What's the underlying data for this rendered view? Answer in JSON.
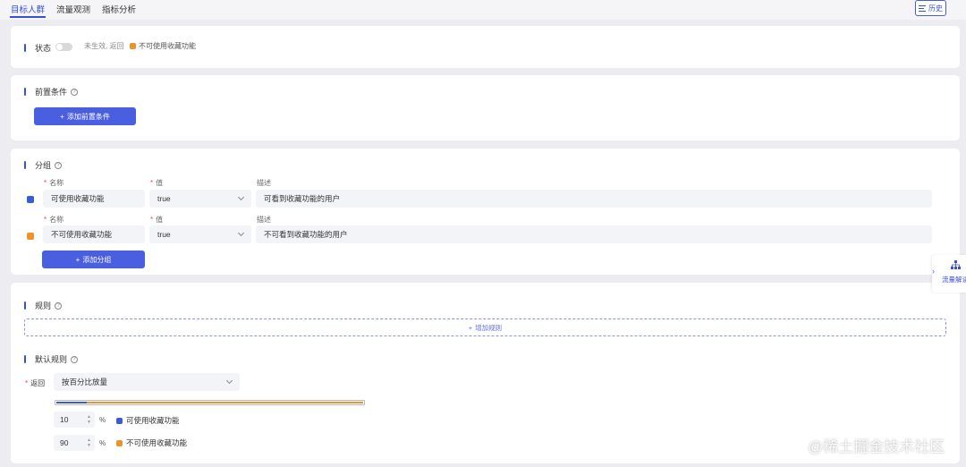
{
  "tabs": [
    "目标人群",
    "流量观测",
    "指标分析"
  ],
  "history_label": "历史",
  "status": {
    "title": "状态",
    "inactive_text": "未生效, 返回",
    "fallback_label": "不可使用收藏功能",
    "colors": {
      "orange": "#f0922c",
      "blue": "#3a5bd9",
      "accent": "#4a5fe0"
    }
  },
  "precondition": {
    "title": "前置条件",
    "add_label": "添加前置条件"
  },
  "grouping": {
    "title": "分组",
    "name_label": "名称",
    "value_label": "值",
    "desc_label": "描述",
    "rows": [
      {
        "name": "可使用收藏功能",
        "value": "true",
        "desc": "可看到收藏功能的用户",
        "color": "#3a5bd9"
      },
      {
        "name": "不可使用收藏功能",
        "value": "true",
        "desc": "不可看到收藏功能的用户",
        "color": "#f0922c"
      }
    ],
    "add_label": "添加分组"
  },
  "rules": {
    "title": "规则",
    "add_label": "增加规则"
  },
  "default_rule": {
    "title": "默认规则",
    "return_label": "返回",
    "mode": "按百分比放量",
    "split": [
      {
        "percent": "10",
        "label": "可使用收藏功能",
        "fraction": 0.1,
        "color": "#3a5bd9"
      },
      {
        "percent": "90",
        "label": "不可使用收藏功能",
        "fraction": 0.9,
        "color": "#f0922c"
      }
    ],
    "unit": "%"
  },
  "side_panel": {
    "label": "流量解读"
  },
  "watermark": "@稀土掘金技术社区"
}
